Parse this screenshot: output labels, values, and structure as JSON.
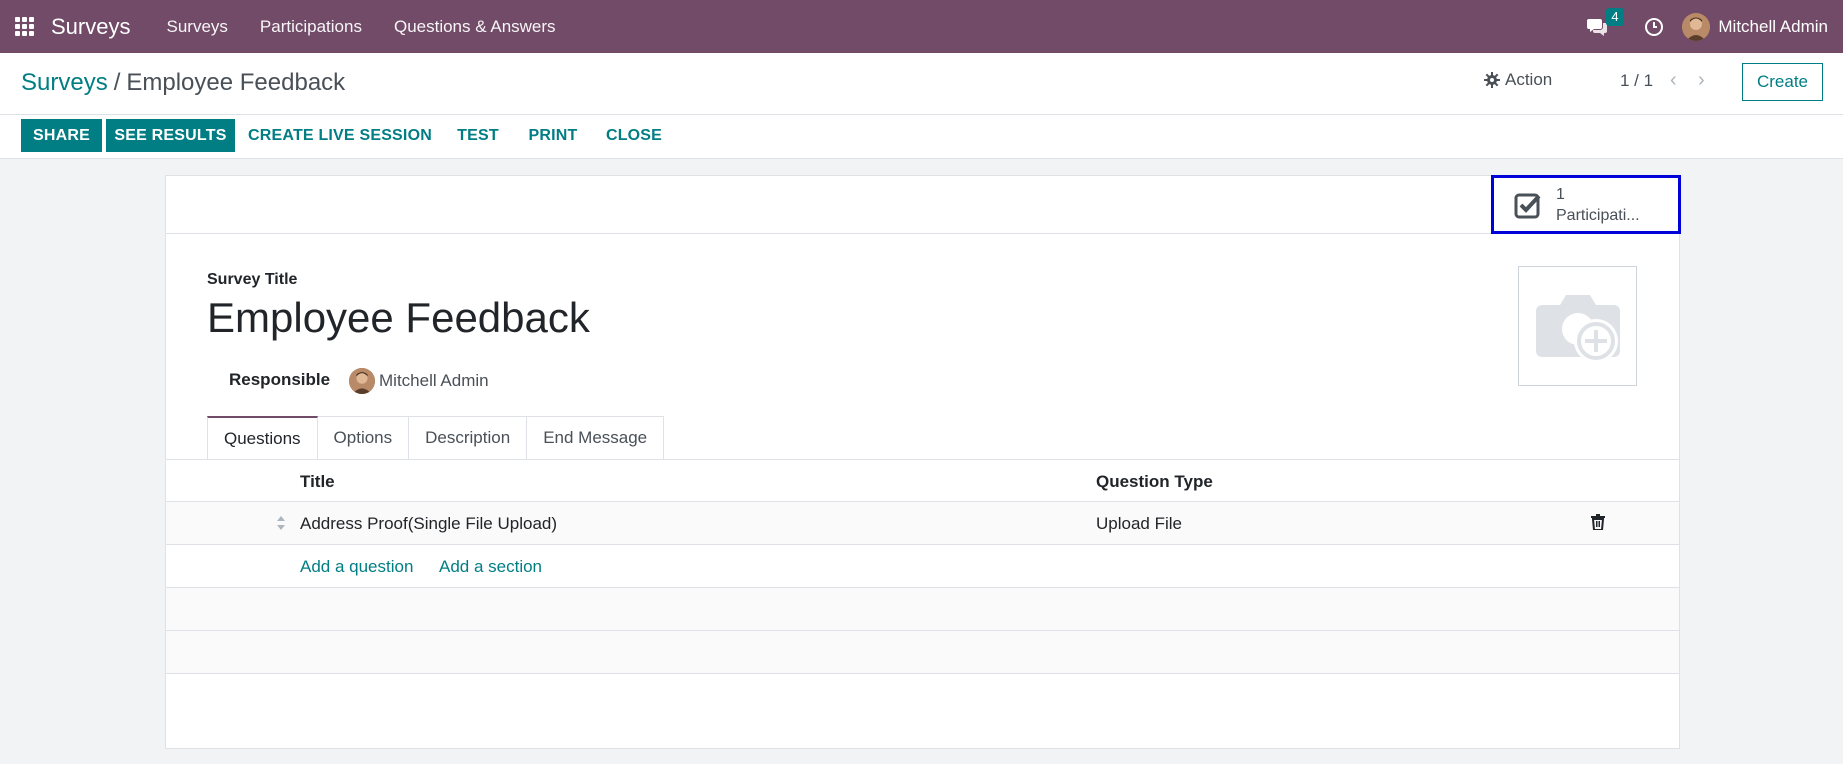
{
  "navbar": {
    "brand": "Surveys",
    "menus": [
      "Surveys",
      "Participations",
      "Questions & Answers"
    ],
    "chat_count": "4",
    "user_name": "Mitchell Admin"
  },
  "control": {
    "breadcrumb_parent": "Surveys",
    "breadcrumb_sep": "/",
    "breadcrumb_current": "Employee Feedback",
    "action_label": "Action",
    "pager_value": "1 / 1",
    "create_label": "Create"
  },
  "buttons": {
    "share": "SHARE",
    "see_results": "SEE RESULTS",
    "create_live_session": "CREATE LIVE SESSION",
    "test": "TEST",
    "print": "PRINT",
    "close": "CLOSE"
  },
  "stat": {
    "count": "1",
    "label": "Participati..."
  },
  "form": {
    "title_label": "Survey Title",
    "title_value": "Employee Feedback",
    "responsible_label": "Responsible",
    "responsible_value": "Mitchell Admin"
  },
  "tabs": [
    "Questions",
    "Options",
    "Description",
    "End Message"
  ],
  "list": {
    "headers": {
      "title": "Title",
      "type": "Question Type"
    },
    "rows": [
      {
        "title": "Address Proof(Single File Upload)",
        "type": "Upload File"
      }
    ],
    "add_question": "Add a question",
    "add_section": "Add a section"
  },
  "colors": {
    "navbar": "#714b67",
    "primary": "#017e84",
    "highlight": "#0000d8"
  }
}
